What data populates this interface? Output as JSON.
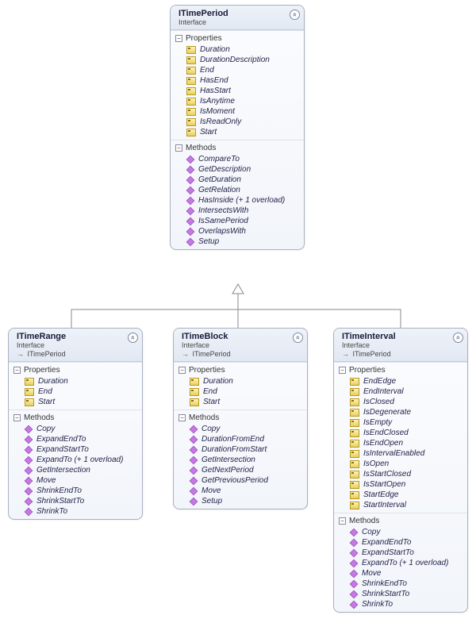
{
  "parent": {
    "name": "ITimePeriod",
    "type": "Interface",
    "sections": [
      {
        "title": "Properties",
        "kind": "prop",
        "items": [
          "Duration",
          "DurationDescription",
          "End",
          "HasEnd",
          "HasStart",
          "IsAnytime",
          "IsMoment",
          "IsReadOnly",
          "Start"
        ]
      },
      {
        "title": "Methods",
        "kind": "method",
        "items": [
          "CompareTo",
          "GetDescription",
          "GetDuration",
          "GetRelation",
          "HasInside (+ 1 overload)",
          "IntersectsWith",
          "IsSamePeriod",
          "OverlapsWith",
          "Setup"
        ]
      }
    ]
  },
  "children": [
    {
      "name": "ITimeRange",
      "type": "Interface",
      "inherits": "ITimePeriod",
      "sections": [
        {
          "title": "Properties",
          "kind": "prop",
          "items": [
            "Duration",
            "End",
            "Start"
          ]
        },
        {
          "title": "Methods",
          "kind": "method",
          "items": [
            "Copy",
            "ExpandEndTo",
            "ExpandStartTo",
            "ExpandTo (+ 1 overload)",
            "GetIntersection",
            "Move",
            "ShrinkEndTo",
            "ShrinkStartTo",
            "ShrinkTo"
          ]
        }
      ]
    },
    {
      "name": "ITimeBlock",
      "type": "Interface",
      "inherits": "ITimePeriod",
      "sections": [
        {
          "title": "Properties",
          "kind": "prop",
          "items": [
            "Duration",
            "End",
            "Start"
          ]
        },
        {
          "title": "Methods",
          "kind": "method",
          "items": [
            "Copy",
            "DurationFromEnd",
            "DurationFromStart",
            "GetIntersection",
            "GetNextPeriod",
            "GetPreviousPeriod",
            "Move",
            "Setup"
          ]
        }
      ]
    },
    {
      "name": "ITimeInterval",
      "type": "Interface",
      "inherits": "ITimePeriod",
      "sections": [
        {
          "title": "Properties",
          "kind": "prop",
          "items": [
            "EndEdge",
            "EndInterval",
            "IsClosed",
            "IsDegenerate",
            "IsEmpty",
            "IsEndClosed",
            "IsEndOpen",
            "IsIntervalEnabled",
            "IsOpen",
            "IsStartClosed",
            "IsStartOpen",
            "StartEdge",
            "StartInterval"
          ]
        },
        {
          "title": "Methods",
          "kind": "method",
          "items": [
            "Copy",
            "ExpandEndTo",
            "ExpandStartTo",
            "ExpandTo (+ 1 overload)",
            "Move",
            "ShrinkEndTo",
            "ShrinkStartTo",
            "ShrinkTo"
          ]
        }
      ]
    }
  ],
  "chart_data": {
    "type": "uml-class-diagram",
    "nodes": [
      {
        "id": "ITimePeriod",
        "kind": "Interface"
      },
      {
        "id": "ITimeRange",
        "kind": "Interface"
      },
      {
        "id": "ITimeBlock",
        "kind": "Interface"
      },
      {
        "id": "ITimeInterval",
        "kind": "Interface"
      }
    ],
    "edges": [
      {
        "from": "ITimeRange",
        "to": "ITimePeriod",
        "relation": "inherits"
      },
      {
        "from": "ITimeBlock",
        "to": "ITimePeriod",
        "relation": "inherits"
      },
      {
        "from": "ITimeInterval",
        "to": "ITimePeriod",
        "relation": "inherits"
      }
    ]
  }
}
